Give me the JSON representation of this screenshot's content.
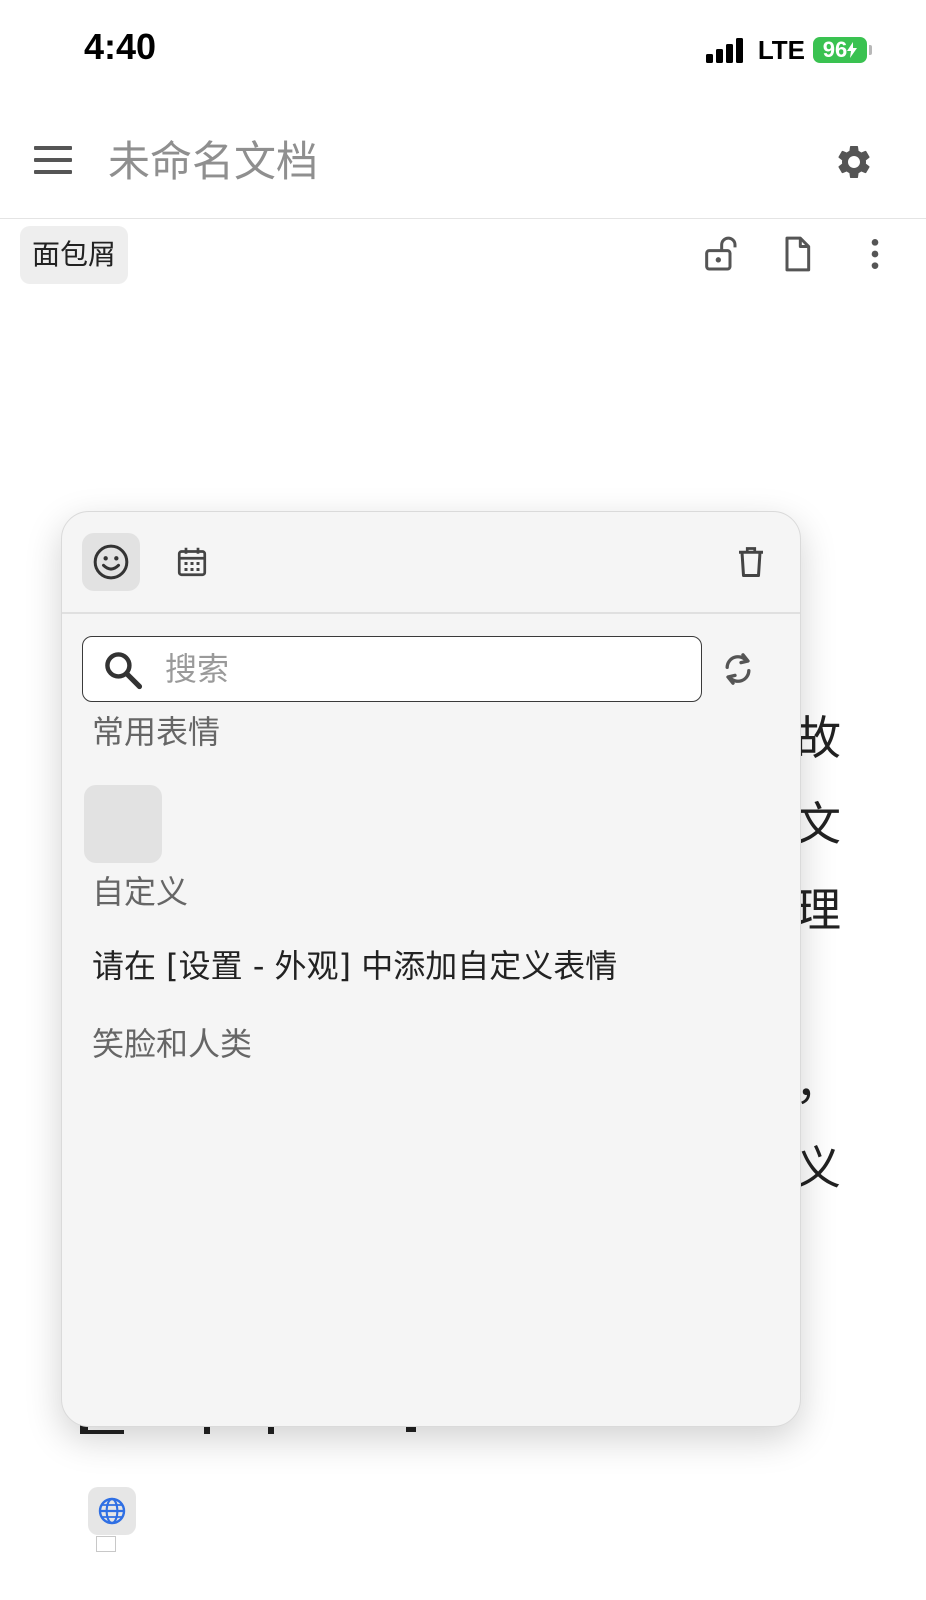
{
  "status_bar": {
    "time": "4:40",
    "network": "LTE",
    "battery": "96",
    "battery_color": "#3ac251"
  },
  "top_bar": {
    "title_placeholder": "未命名文档",
    "menu_icon": "hamburger-menu-icon",
    "settings_icon": "gear-icon"
  },
  "breadcrumb": {
    "label": "面包屑"
  },
  "toolbar_icons": [
    "unlock-icon",
    "document-icon",
    "more-vertical-icon"
  ],
  "document_background": {
    "visible_chars": [
      "故",
      "文",
      "理",
      "，",
      "义"
    ]
  },
  "emoji_panel": {
    "tabs": [
      "smiley-icon",
      "calendar-icon"
    ],
    "delete_icon": "trash-icon",
    "search": {
      "placeholder": "搜索",
      "value": ""
    },
    "refresh_icon": "refresh-icon",
    "sections": {
      "frequent": "常用表情",
      "custom": "自定义",
      "custom_hint": "请在 [设置 - 外观] 中添加自定义表情",
      "smileys": "笑脸和人类"
    }
  },
  "bottom": {
    "globe_icon": "globe-icon"
  }
}
